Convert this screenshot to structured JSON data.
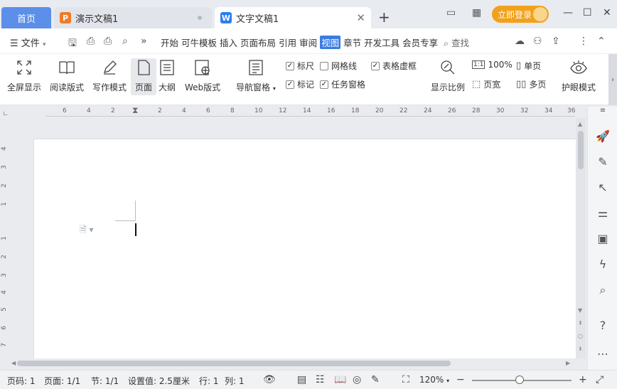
{
  "tabs": {
    "home": "首页",
    "doc_inactive": "演示文稿1",
    "doc_active": "文字文稿1",
    "login": "立即登录"
  },
  "menu": {
    "file": "文件",
    "items": [
      "开始",
      "可牛模板",
      "插入",
      "页面布局",
      "引用",
      "审阅",
      "视图",
      "章节",
      "开发工具",
      "会员专享"
    ],
    "selected": "视图",
    "search": "查找"
  },
  "ribbon": {
    "buttons": [
      "全屏显示",
      "阅读版式",
      "写作模式",
      "页面",
      "大纲",
      "Web版式",
      "导航窗格"
    ],
    "checks": [
      {
        "label": "标尺",
        "checked": true
      },
      {
        "label": "网格线",
        "checked": false
      },
      {
        "label": "表格虚框",
        "checked": true
      },
      {
        "label": "标记",
        "checked": true
      },
      {
        "label": "任务窗格",
        "checked": true
      }
    ],
    "zoom_ratio": "显示比例",
    "zoom_100": "100%",
    "single_page": "单页",
    "page_width": "页宽",
    "multi_page": "多页",
    "eye_mode": "护眼模式"
  },
  "ruler": {
    "h_ticks": [
      "6",
      "4",
      "2",
      "2",
      "4",
      "6",
      "8",
      "10",
      "12",
      "14",
      "16",
      "18",
      "20",
      "22",
      "24",
      "26",
      "28",
      "30",
      "32",
      "34",
      "36"
    ],
    "v_ticks": [
      "4",
      "3",
      "2",
      "1",
      "1",
      "2",
      "3",
      "4",
      "5",
      "6",
      "7"
    ]
  },
  "status": {
    "page_no": "页码: 1",
    "pages": "页面: 1/1",
    "section": "节: 1/1",
    "setting": "设置值: 2.5厘米",
    "row": "行: 1",
    "col": "列: 1",
    "zoom": "120%",
    "zoom_level": 0.48
  }
}
